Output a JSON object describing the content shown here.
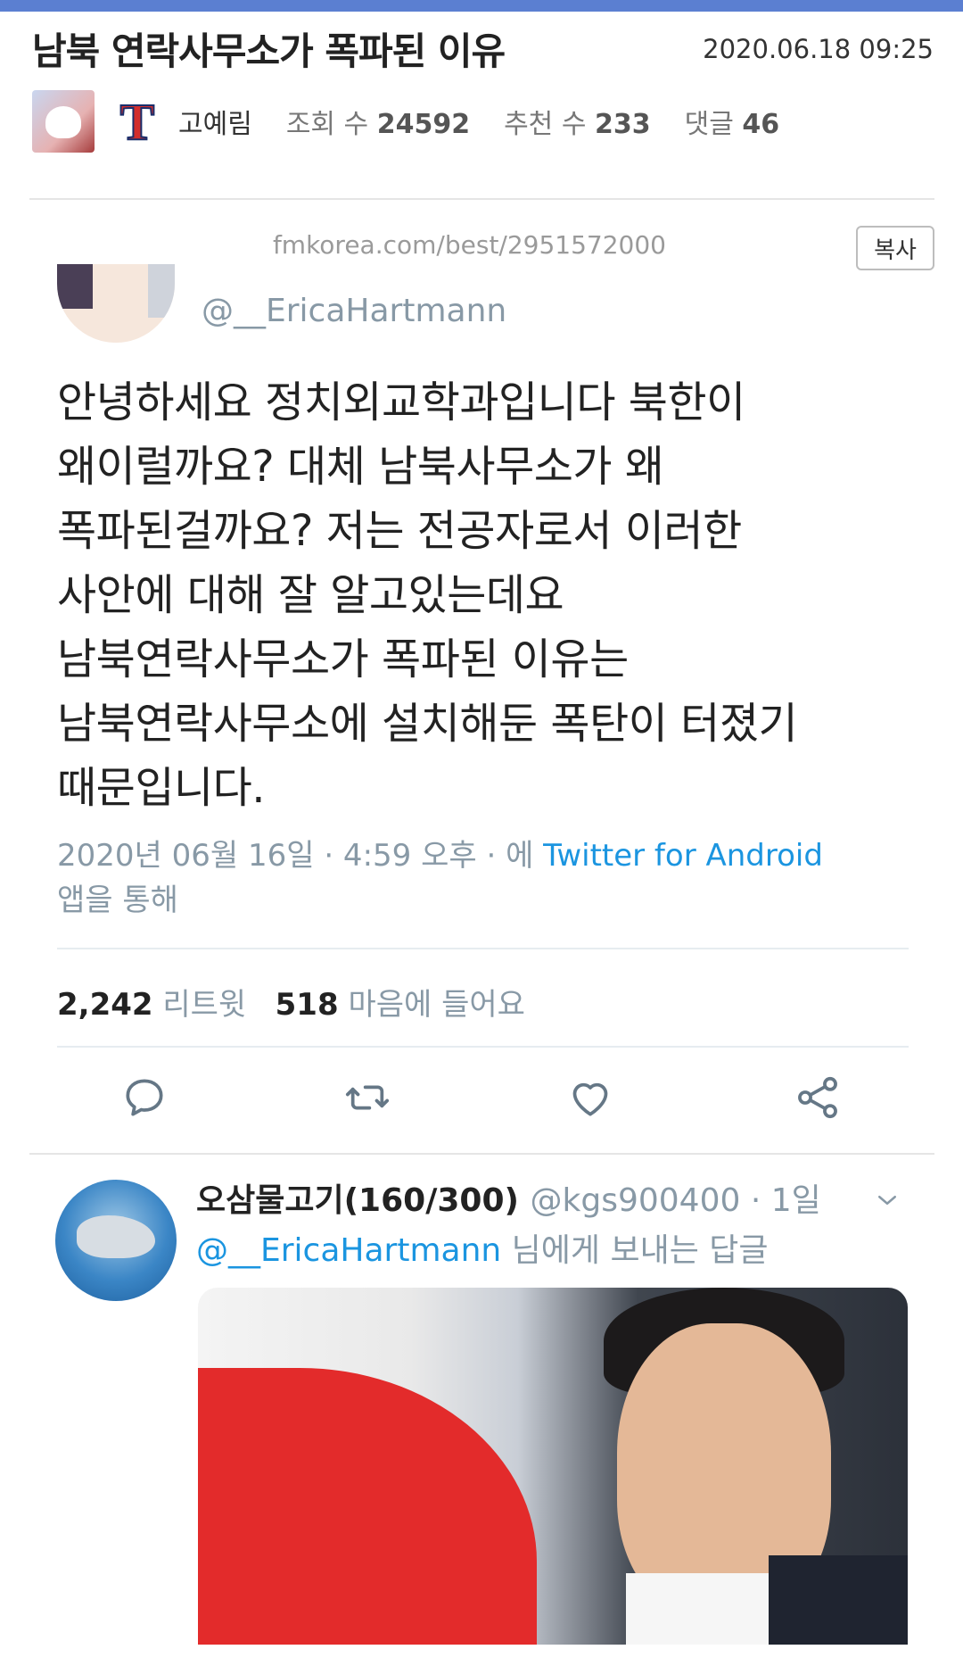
{
  "post": {
    "title": "남북 연락사무소가 폭파된 이유",
    "datetime": "2020.06.18 09:25",
    "author": "고예림",
    "views_label": "조회 수",
    "views": "24592",
    "likes_label": "추천 수",
    "likes": "233",
    "comments_label": "댓글",
    "comments": "46",
    "url": "fmkorea.com/best/2951572000",
    "copy_label": "복사"
  },
  "tweet": {
    "handle": "@__EricaHartmann",
    "body": "안녕하세요 정치외교학과입니다 북한이\n왜이럴까요? 대체 남북사무소가 왜\n폭파된걸까요? 저는 전공자로서 이러한\n사안에 대해 잘 알고있는데요\n남북연락사무소가 폭파된 이유는\n남북연락사무소에 설치해둔 폭탄이 터졌기\n때문입니다.",
    "time_prefix": "2020년 06월 16일 · 4:59 오후 · 에",
    "app": "Twitter for Android",
    "time_suffix": "앱을 통해",
    "retweets": "2,242",
    "retweets_label": "리트윗",
    "likes": "518",
    "likes_label": "마음에 들어요",
    "actions": [
      "reply-icon",
      "retweet-icon",
      "heart-icon",
      "share-icon"
    ]
  },
  "reply": {
    "name": "오삼물고기(160/300)",
    "handle_time": "@kgs900400 · 1일",
    "mention": "@__EricaHartmann",
    "reply_text": "님에게 보내는 답글"
  },
  "colors": {
    "top_bar": "#5b7fd1",
    "twitter_blue": "#1b95e0",
    "muted": "#8899a6"
  }
}
